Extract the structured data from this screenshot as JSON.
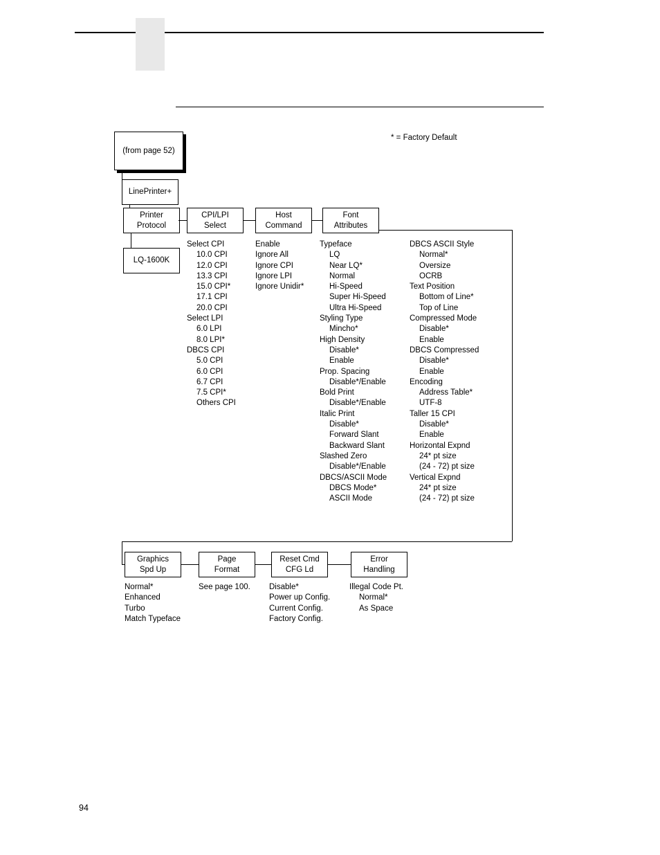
{
  "page": {
    "number": "94",
    "legend": "* = Factory Default"
  },
  "boxes": {
    "from_page": {
      "line1": "(from page 52)"
    },
    "lineprinter": {
      "line1": "LinePrinter+"
    },
    "printer_protocol": {
      "line1": "Printer",
      "line2": "Protocol"
    },
    "cpi_lpi_select": {
      "line1": "CPI/LPI",
      "line2": "Select"
    },
    "host_command": {
      "line1": "Host",
      "line2": "Command"
    },
    "font_attributes": {
      "line1": "Font",
      "line2": "Attributes"
    },
    "lq1600k": {
      "line1": "LQ-1600K"
    },
    "graphics_spd_up": {
      "line1": "Graphics",
      "line2": "Spd Up"
    },
    "page_format": {
      "line1": "Page",
      "line2": "Format"
    },
    "reset_cmd": {
      "line1": "Reset Cmd",
      "line2": "CFG Ld"
    },
    "error_handling": {
      "line1": "Error",
      "line2": "Handling"
    }
  },
  "columns": {
    "cpi_lpi": [
      {
        "text": "Select CPI",
        "indent": 0
      },
      {
        "text": "10.0 CPI",
        "indent": 1
      },
      {
        "text": "12.0 CPI",
        "indent": 1
      },
      {
        "text": "13.3 CPI",
        "indent": 1
      },
      {
        "text": "15.0 CPI*",
        "indent": 1
      },
      {
        "text": "17.1 CPI",
        "indent": 1
      },
      {
        "text": "20.0 CPI",
        "indent": 1
      },
      {
        "text": "Select LPI",
        "indent": 0
      },
      {
        "text": "6.0 LPI",
        "indent": 1
      },
      {
        "text": "8.0 LPI*",
        "indent": 1
      },
      {
        "text": "DBCS CPI",
        "indent": 0
      },
      {
        "text": "5.0 CPI",
        "indent": 1
      },
      {
        "text": "6.0 CPI",
        "indent": 1
      },
      {
        "text": "6.7 CPI",
        "indent": 1
      },
      {
        "text": "7.5 CPI*",
        "indent": 1
      },
      {
        "text": "Others CPI",
        "indent": 1
      }
    ],
    "host_command": [
      {
        "text": "Enable",
        "indent": 0
      },
      {
        "text": "Ignore All",
        "indent": 0
      },
      {
        "text": "Ignore CPI",
        "indent": 0
      },
      {
        "text": "Ignore LPI",
        "indent": 0
      },
      {
        "text": "Ignore Unidir*",
        "indent": 0
      }
    ],
    "font_attributes_1": [
      {
        "text": "Typeface",
        "indent": 0
      },
      {
        "text": "LQ",
        "indent": 1
      },
      {
        "text": "Near LQ*",
        "indent": 1
      },
      {
        "text": "Normal",
        "indent": 1
      },
      {
        "text": "Hi-Speed",
        "indent": 1
      },
      {
        "text": "Super Hi-Speed",
        "indent": 1
      },
      {
        "text": "Ultra Hi-Speed",
        "indent": 1
      },
      {
        "text": "Styling Type",
        "indent": 0
      },
      {
        "text": "Mincho*",
        "indent": 1
      },
      {
        "text": "High Density",
        "indent": 0
      },
      {
        "text": "Disable*",
        "indent": 1
      },
      {
        "text": "Enable",
        "indent": 1
      },
      {
        "text": "Prop. Spacing",
        "indent": 0
      },
      {
        "text": "Disable*/Enable",
        "indent": 1
      },
      {
        "text": "Bold Print",
        "indent": 0
      },
      {
        "text": "Disable*/Enable",
        "indent": 1
      },
      {
        "text": "Italic Print",
        "indent": 0
      },
      {
        "text": "Disable*",
        "indent": 1
      },
      {
        "text": "Forward Slant",
        "indent": 1
      },
      {
        "text": "Backward Slant",
        "indent": 1
      },
      {
        "text": "Slashed Zero",
        "indent": 0
      },
      {
        "text": "Disable*/Enable",
        "indent": 1
      },
      {
        "text": "DBCS/ASCII Mode",
        "indent": 0
      },
      {
        "text": "DBCS Mode*",
        "indent": 1
      },
      {
        "text": "ASCII Mode",
        "indent": 1
      }
    ],
    "font_attributes_2": [
      {
        "text": "DBCS ASCII Style",
        "indent": 0
      },
      {
        "text": "Normal*",
        "indent": 1
      },
      {
        "text": "Oversize",
        "indent": 1
      },
      {
        "text": "OCRB",
        "indent": 1
      },
      {
        "text": "Text Position",
        "indent": 0
      },
      {
        "text": "Bottom of Line*",
        "indent": 1
      },
      {
        "text": "Top of Line",
        "indent": 1
      },
      {
        "text": "Compressed Mode",
        "indent": 0
      },
      {
        "text": "Disable*",
        "indent": 1
      },
      {
        "text": "Enable",
        "indent": 1
      },
      {
        "text": "DBCS Compressed",
        "indent": 0
      },
      {
        "text": "Disable*",
        "indent": 1
      },
      {
        "text": "Enable",
        "indent": 1
      },
      {
        "text": "Encoding",
        "indent": 0
      },
      {
        "text": "Address Table*",
        "indent": 1
      },
      {
        "text": "UTF-8",
        "indent": 1
      },
      {
        "text": "Taller 15 CPI",
        "indent": 0
      },
      {
        "text": "Disable*",
        "indent": 1
      },
      {
        "text": "Enable",
        "indent": 1
      },
      {
        "text": "Horizontal Expnd",
        "indent": 0
      },
      {
        "text": "24* pt size",
        "indent": 1
      },
      {
        "text": "(24 - 72) pt size",
        "indent": 1
      },
      {
        "text": "Vertical Expnd",
        "indent": 0
      },
      {
        "text": "24* pt size",
        "indent": 1
      },
      {
        "text": "(24 - 72) pt size",
        "indent": 1
      }
    ],
    "graphics_spd_up": [
      {
        "text": "Normal*",
        "indent": 0
      },
      {
        "text": "Enhanced",
        "indent": 0
      },
      {
        "text": "Turbo",
        "indent": 0
      },
      {
        "text": "Match Typeface",
        "indent": 0
      }
    ],
    "page_format": [
      {
        "text": "See page 100.",
        "indent": 0
      }
    ],
    "reset_cmd": [
      {
        "text": "Disable*",
        "indent": 0
      },
      {
        "text": "Power up Config.",
        "indent": 0
      },
      {
        "text": "Current Config.",
        "indent": 0
      },
      {
        "text": "Factory Config.",
        "indent": 0
      }
    ],
    "error_handling": [
      {
        "text": "Illegal Code Pt.",
        "indent": 0
      },
      {
        "text": "Normal*",
        "indent": 1
      },
      {
        "text": "As Space",
        "indent": 1
      }
    ]
  }
}
